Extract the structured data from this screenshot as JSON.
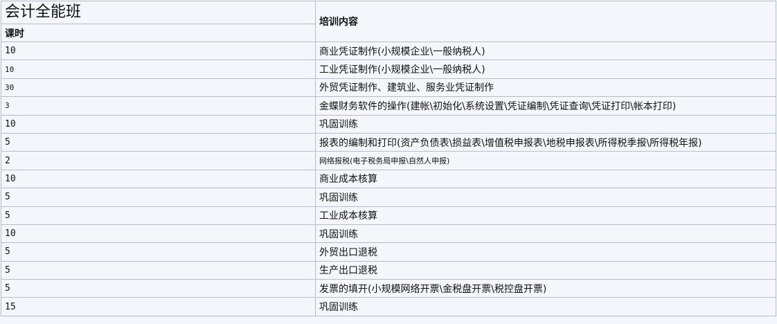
{
  "title": "会计全能班",
  "columns": {
    "hours": "课时",
    "content": "培训内容"
  },
  "rows": [
    {
      "hours": "10",
      "content": "商业凭证制作(小规模企业\\一般纳税人)",
      "small_hours": false,
      "small_content": false
    },
    {
      "hours": "10",
      "content": "工业凭证制作(小规模企业\\一般纳税人)",
      "small_hours": true,
      "small_content": false
    },
    {
      "hours": "30",
      "content": "外贸凭证制作、建筑业、服务业凭证制作",
      "small_hours": true,
      "small_content": false
    },
    {
      "hours": "3",
      "content": "金蝶财务软件的操作(建帐\\初始化\\系统设置\\凭证编制\\凭证查询\\凭证打印\\帐本打印)",
      "small_hours": true,
      "small_content": false
    },
    {
      "hours": "10",
      "content": "巩固训练",
      "small_hours": false,
      "small_content": false
    },
    {
      "hours": "5",
      "content": "报表的编制和打印(资产负债表\\损益表\\增值税申报表\\地税申报表\\所得税季报\\所得税年报)",
      "small_hours": false,
      "small_content": false
    },
    {
      "hours": "2",
      "content": "网络报税(电子税务局申报\\自然人申报)",
      "small_hours": false,
      "small_content": true
    },
    {
      "hours": "10",
      "content": "商业成本核算",
      "small_hours": false,
      "small_content": false
    },
    {
      "hours": "5",
      "content": "巩固训练",
      "small_hours": false,
      "small_content": false
    },
    {
      "hours": "5",
      "content": "工业成本核算",
      "small_hours": false,
      "small_content": false
    },
    {
      "hours": "10",
      "content": "巩固训练",
      "small_hours": false,
      "small_content": false
    },
    {
      "hours": "5",
      "content": "外贸出口退税",
      "small_hours": false,
      "small_content": false
    },
    {
      "hours": "5",
      "content": "生产出口退税",
      "small_hours": false,
      "small_content": false
    },
    {
      "hours": "5",
      "content": "发票的填开(小规模网络开票\\金税盘开票\\税控盘开票)",
      "small_hours": false,
      "small_content": false
    },
    {
      "hours": "15",
      "content": "巩固训练",
      "small_hours": false,
      "small_content": false
    }
  ]
}
